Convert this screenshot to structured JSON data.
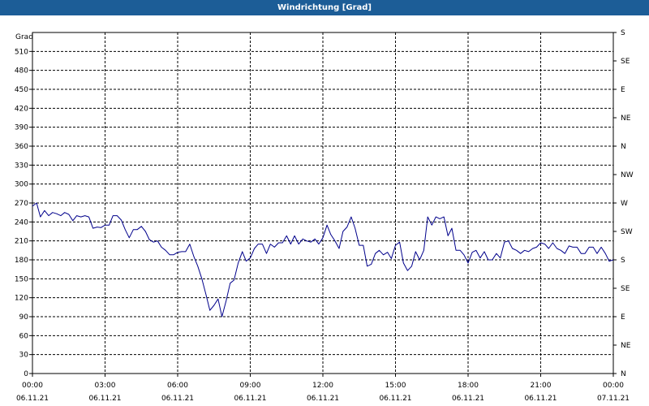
{
  "window": {
    "title": "Windrichtung [Grad]"
  },
  "chart_data": {
    "type": "line",
    "title": "Windrichtung [Grad]",
    "ylabel": "Grad",
    "xlabel": "",
    "ylim": [
      0,
      540
    ],
    "xlim_hours": [
      0,
      24
    ],
    "grid": true,
    "y_ticks": [
      0,
      30,
      60,
      90,
      120,
      150,
      180,
      210,
      240,
      270,
      300,
      330,
      360,
      390,
      420,
      450,
      480,
      510
    ],
    "y_right_ticks": [
      {
        "value": 0,
        "label": "N"
      },
      {
        "value": 45,
        "label": "NE"
      },
      {
        "value": 90,
        "label": "E"
      },
      {
        "value": 135,
        "label": "SE"
      },
      {
        "value": 180,
        "label": "S"
      },
      {
        "value": 225,
        "label": "SW"
      },
      {
        "value": 270,
        "label": "W"
      },
      {
        "value": 315,
        "label": "NW"
      },
      {
        "value": 360,
        "label": "N"
      },
      {
        "value": 405,
        "label": "NE"
      },
      {
        "value": 450,
        "label": "E"
      },
      {
        "value": 495,
        "label": "SE"
      },
      {
        "value": 540,
        "label": "S"
      }
    ],
    "x_ticks": [
      {
        "hour": 0,
        "time": "00:00",
        "date": "06.11.21"
      },
      {
        "hour": 3,
        "time": "03:00",
        "date": "06.11.21"
      },
      {
        "hour": 6,
        "time": "06:00",
        "date": "06.11.21"
      },
      {
        "hour": 9,
        "time": "09:00",
        "date": "06.11.21"
      },
      {
        "hour": 12,
        "time": "12:00",
        "date": "06.11.21"
      },
      {
        "hour": 15,
        "time": "15:00",
        "date": "06.11.21"
      },
      {
        "hour": 18,
        "time": "18:00",
        "date": "06.11.21"
      },
      {
        "hour": 21,
        "time": "21:00",
        "date": "06.11.21"
      },
      {
        "hour": 24,
        "time": "00:00",
        "date": "07.11.21"
      }
    ],
    "series": [
      {
        "color": "#00008b",
        "points": [
          [
            0.0,
            265
          ],
          [
            0.17,
            270
          ],
          [
            0.33,
            248
          ],
          [
            0.5,
            258
          ],
          [
            0.67,
            250
          ],
          [
            0.83,
            255
          ],
          [
            1.0,
            253
          ],
          [
            1.17,
            250
          ],
          [
            1.33,
            255
          ],
          [
            1.5,
            252
          ],
          [
            1.67,
            242
          ],
          [
            1.83,
            250
          ],
          [
            2.0,
            248
          ],
          [
            2.17,
            250
          ],
          [
            2.33,
            248
          ],
          [
            2.5,
            230
          ],
          [
            2.67,
            232
          ],
          [
            2.83,
            231
          ],
          [
            3.0,
            235
          ],
          [
            3.17,
            235
          ],
          [
            3.33,
            250
          ],
          [
            3.5,
            250
          ],
          [
            3.67,
            243
          ],
          [
            3.83,
            228
          ],
          [
            4.0,
            215
          ],
          [
            4.17,
            228
          ],
          [
            4.33,
            228
          ],
          [
            4.5,
            233
          ],
          [
            4.67,
            225
          ],
          [
            4.83,
            212
          ],
          [
            5.0,
            208
          ],
          [
            5.17,
            210
          ],
          [
            5.33,
            200
          ],
          [
            5.5,
            195
          ],
          [
            5.67,
            188
          ],
          [
            5.83,
            188
          ],
          [
            6.0,
            192
          ],
          [
            6.17,
            193
          ],
          [
            6.33,
            193
          ],
          [
            6.5,
            205
          ],
          [
            6.67,
            185
          ],
          [
            6.83,
            170
          ],
          [
            7.0,
            150
          ],
          [
            7.17,
            125
          ],
          [
            7.33,
            100
          ],
          [
            7.5,
            108
          ],
          [
            7.67,
            118
          ],
          [
            7.83,
            90
          ],
          [
            8.0,
            115
          ],
          [
            8.17,
            143
          ],
          [
            8.33,
            148
          ],
          [
            8.5,
            175
          ],
          [
            8.67,
            193
          ],
          [
            8.83,
            178
          ],
          [
            9.0,
            183
          ],
          [
            9.17,
            198
          ],
          [
            9.33,
            205
          ],
          [
            9.5,
            205
          ],
          [
            9.67,
            190
          ],
          [
            9.83,
            205
          ],
          [
            10.0,
            200
          ],
          [
            10.17,
            207
          ],
          [
            10.33,
            207
          ],
          [
            10.5,
            218
          ],
          [
            10.67,
            205
          ],
          [
            10.83,
            218
          ],
          [
            11.0,
            205
          ],
          [
            11.17,
            213
          ],
          [
            11.33,
            210
          ],
          [
            11.5,
            208
          ],
          [
            11.67,
            213
          ],
          [
            11.83,
            205
          ],
          [
            12.0,
            215
          ],
          [
            12.17,
            235
          ],
          [
            12.33,
            220
          ],
          [
            12.5,
            210
          ],
          [
            12.67,
            198
          ],
          [
            12.83,
            225
          ],
          [
            13.0,
            232
          ],
          [
            13.17,
            248
          ],
          [
            13.33,
            230
          ],
          [
            13.5,
            203
          ],
          [
            13.67,
            203
          ],
          [
            13.83,
            170
          ],
          [
            14.0,
            173
          ],
          [
            14.17,
            190
          ],
          [
            14.33,
            195
          ],
          [
            14.5,
            188
          ],
          [
            14.67,
            192
          ],
          [
            14.83,
            182
          ],
          [
            15.0,
            203
          ],
          [
            15.17,
            208
          ],
          [
            15.33,
            175
          ],
          [
            15.5,
            163
          ],
          [
            15.67,
            170
          ],
          [
            15.83,
            193
          ],
          [
            16.0,
            180
          ],
          [
            16.17,
            195
          ],
          [
            16.33,
            248
          ],
          [
            16.5,
            235
          ],
          [
            16.67,
            248
          ],
          [
            16.83,
            245
          ],
          [
            17.0,
            248
          ],
          [
            17.17,
            218
          ],
          [
            17.33,
            230
          ],
          [
            17.5,
            195
          ],
          [
            17.67,
            195
          ],
          [
            17.83,
            188
          ],
          [
            18.0,
            175
          ],
          [
            18.17,
            192
          ],
          [
            18.33,
            195
          ],
          [
            18.5,
            183
          ],
          [
            18.67,
            193
          ],
          [
            18.83,
            180
          ],
          [
            19.0,
            180
          ],
          [
            19.17,
            190
          ],
          [
            19.33,
            183
          ],
          [
            19.5,
            208
          ],
          [
            19.67,
            210
          ],
          [
            19.83,
            198
          ],
          [
            20.0,
            195
          ],
          [
            20.17,
            190
          ],
          [
            20.33,
            195
          ],
          [
            20.5,
            193
          ],
          [
            20.67,
            198
          ],
          [
            20.83,
            200
          ],
          [
            21.0,
            207
          ],
          [
            21.17,
            205
          ],
          [
            21.33,
            198
          ],
          [
            21.5,
            207
          ],
          [
            21.67,
            198
          ],
          [
            21.83,
            195
          ],
          [
            22.0,
            190
          ],
          [
            22.17,
            202
          ],
          [
            22.33,
            200
          ],
          [
            22.5,
            200
          ],
          [
            22.67,
            190
          ],
          [
            22.83,
            190
          ],
          [
            23.0,
            200
          ],
          [
            23.17,
            200
          ],
          [
            23.33,
            190
          ],
          [
            23.5,
            200
          ],
          [
            23.67,
            190
          ],
          [
            23.83,
            178
          ],
          [
            24.0,
            180
          ]
        ]
      }
    ]
  }
}
